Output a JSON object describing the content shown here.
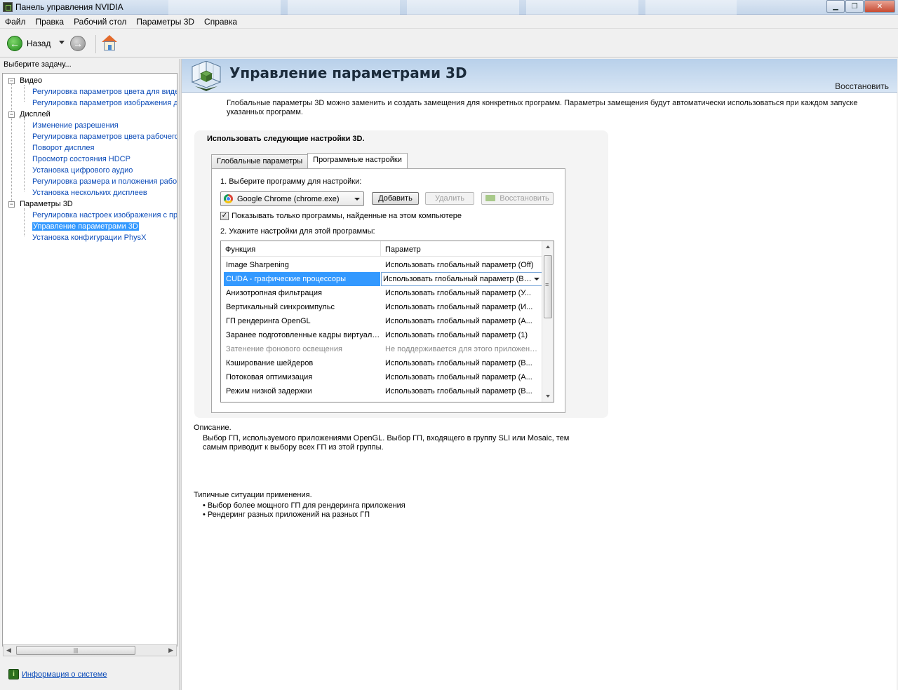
{
  "window": {
    "title": "Панель управления NVIDIA",
    "controls": [
      "minimize",
      "maximize",
      "close"
    ]
  },
  "menu": [
    {
      "label": "Файл"
    },
    {
      "label": "Правка"
    },
    {
      "label": "Рабочий стол"
    },
    {
      "label": "Параметры 3D"
    },
    {
      "label": "Справка"
    }
  ],
  "toolbar": {
    "back_label": "Назад"
  },
  "sidebar": {
    "header": "Выберите задачу...",
    "categories": [
      {
        "label": "Видео",
        "items": [
          {
            "label": "Регулировка параметров цвета для видео"
          },
          {
            "label": "Регулировка параметров изображения для видео"
          }
        ]
      },
      {
        "label": "Дисплей",
        "items": [
          {
            "label": "Изменение разрешения"
          },
          {
            "label": "Регулировка параметров цвета рабочего стола"
          },
          {
            "label": "Поворот дисплея"
          },
          {
            "label": "Просмотр состояния HDCP"
          },
          {
            "label": "Установка цифрового аудио"
          },
          {
            "label": "Регулировка размера и положения рабочего стола"
          },
          {
            "label": "Установка нескольких дисплеев"
          }
        ]
      },
      {
        "label": "Параметры 3D",
        "items": [
          {
            "label": "Регулировка настроек изображения с просмотром"
          },
          {
            "label": "Управление параметрами 3D",
            "selected": true
          },
          {
            "label": "Установка конфигурации PhysX"
          }
        ]
      }
    ],
    "system_info_link": "Информация о системе"
  },
  "main": {
    "title": "Управление параметрами 3D",
    "restore_link": "Восстановить",
    "intro": "Глобальные параметры 3D можно заменить и создать замещения для конкретных программ. Параметры замещения будут автоматически использоваться при каждом запуске указанных программ.",
    "settings_title": "Использовать следующие настройки 3D.",
    "tabs": [
      {
        "label": "Глобальные параметры"
      },
      {
        "label": "Программные настройки",
        "active": true
      }
    ],
    "step1_label": "1. Выберите программу для настройки:",
    "program_select": "Google Chrome (chrome.exe)",
    "add_button": "Добавить",
    "delete_button": "Удалить",
    "restore_button": "Восстановить",
    "show_only_checkbox": {
      "label": "Показывать только программы, найденные на этом компьютере",
      "checked": true
    },
    "step2_label": "2. Укажите настройки для этой программы:",
    "grid": {
      "headers": [
        "Функция",
        "Параметр"
      ],
      "rows": [
        {
          "feature": "Image Sharpening",
          "value": "Использовать глобальный параметр (Off)"
        },
        {
          "feature": "CUDA - графические процессоры",
          "value": "Использовать глобальный параметр (Все)",
          "selected": true
        },
        {
          "feature": "Анизотропная фильтрация",
          "value": "Использовать глобальный параметр (У..."
        },
        {
          "feature": "Вертикальный синхроимпульс",
          "value": "Использовать глобальный параметр (И..."
        },
        {
          "feature": "ГП рендеринга OpenGL",
          "value": "Использовать глобальный параметр (А..."
        },
        {
          "feature": "Заранее подготовленные кадры виртуальной реальности",
          "value": "Использовать глобальный параметр (1)"
        },
        {
          "feature": "Затенение фонового освещения",
          "value": "Не поддерживается для этого приложения",
          "disabled": true
        },
        {
          "feature": "Кэширование шейдеров",
          "value": "Использовать глобальный параметр (В..."
        },
        {
          "feature": "Потоковая оптимизация",
          "value": "Использовать глобальный параметр (А..."
        },
        {
          "feature": "Режим низкой задержки",
          "value": "Использовать глобальный параметр (В..."
        }
      ]
    },
    "description_label": "Описание.",
    "description_text": "Выбор ГП, используемого приложениями OpenGL. Выбор ГП, входящего в группу SLI или Mosaic, тем самым приводит к выбору всех ГП из этой группы.",
    "usage_label": "Типичные ситуации применения.",
    "usage_items": [
      "Выбор более мощного ГП для рендеринга приложения",
      "Рендеринг разных приложений на разных ГП"
    ]
  }
}
